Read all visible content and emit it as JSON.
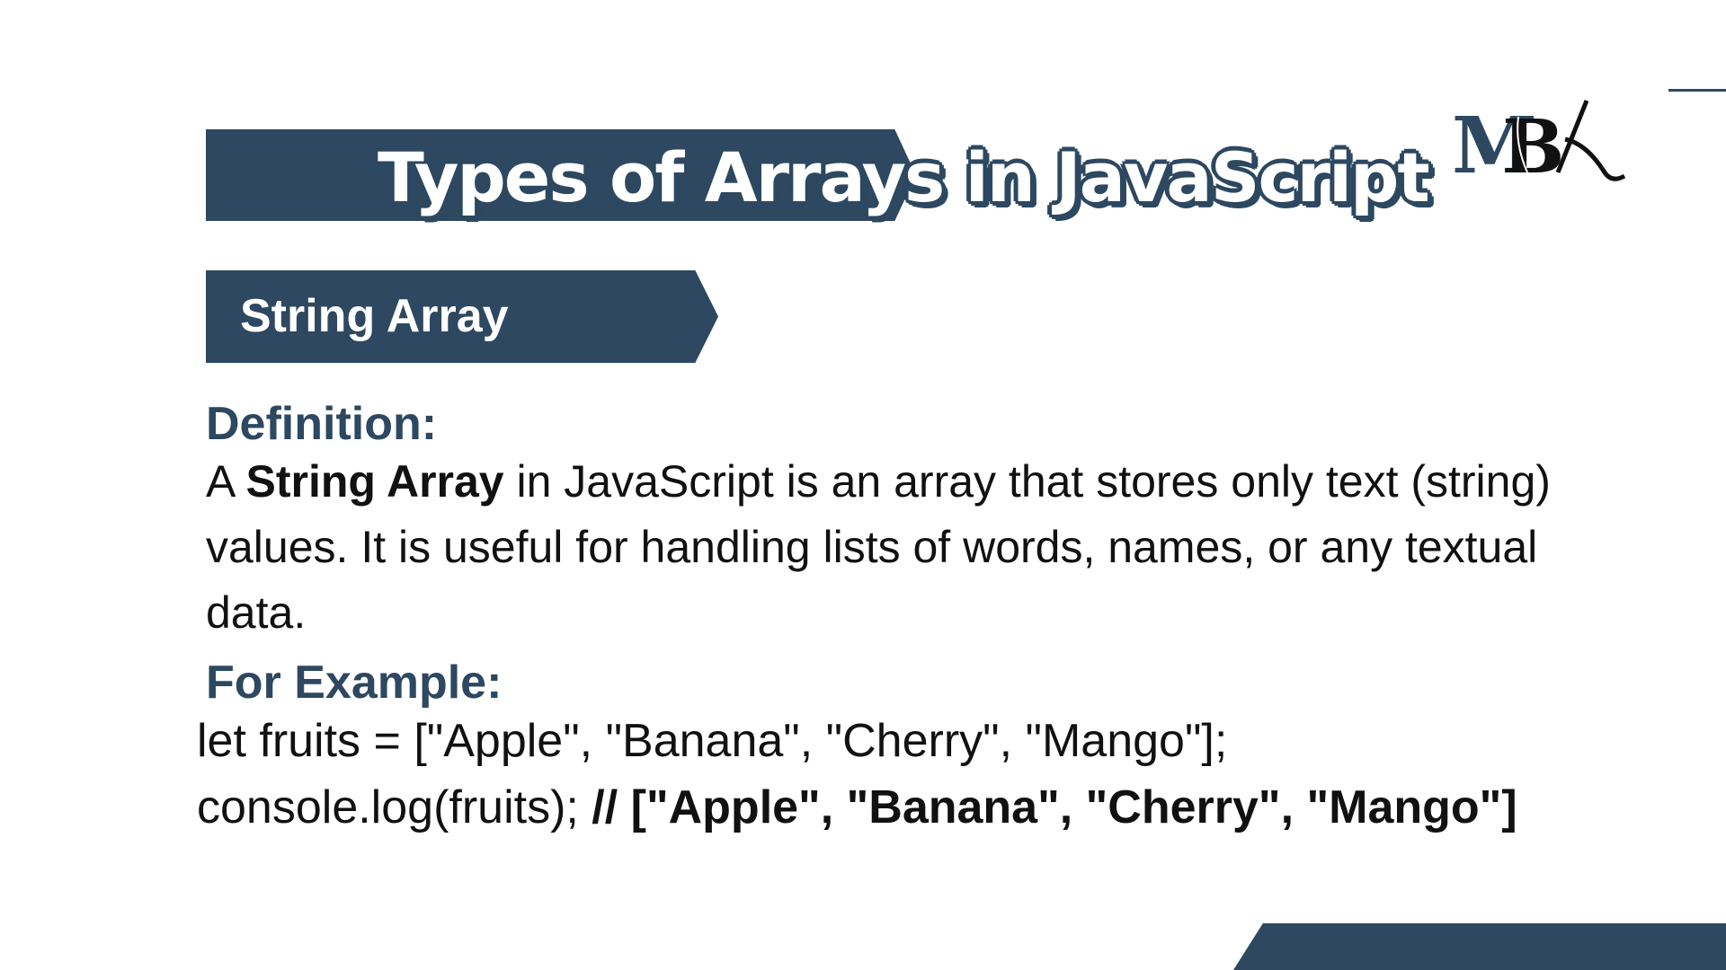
{
  "slide": {
    "title": "Types of Arrays in JavaScript",
    "section_label": "String Array",
    "definition_heading": "Definition:",
    "definition": {
      "prefix": "A ",
      "bold": "String Array",
      "suffix": " in JavaScript is an array that stores only text (string) values. It is useful for handling lists of words, names, or any textual data."
    },
    "example_heading": "For Example:",
    "code": {
      "line1": "let fruits = [\"Apple\", \"Banana\", \"Cherry\", \"Mango\"];",
      "line2_code": "console.log(fruits); ",
      "line2_comment": "// [\"Apple\", \"Banana\", \"Cherry\", \"Mango\"]"
    },
    "logo_text": "MBK"
  },
  "colors": {
    "accent": "#2d4860",
    "text": "#111111",
    "background": "#ffffff"
  }
}
